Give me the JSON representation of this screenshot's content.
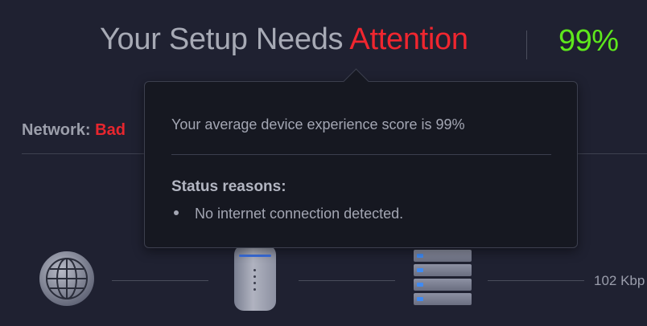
{
  "header": {
    "title_prefix": "Your Setup Needs",
    "title_accent": "Attention",
    "score": "99%"
  },
  "network": {
    "label": "Network:",
    "status": "Bad"
  },
  "topology": {
    "speed": "102 Kbp"
  },
  "tooltip": {
    "score_text": "Your average device experience score is 99%",
    "reasons_heading": "Status reasons:",
    "reasons": [
      "No internet connection detected."
    ]
  },
  "colors": {
    "background": "#1f2131",
    "attention": "#f0262f",
    "score_good": "#5ee81c",
    "status_bad": "#e8262e"
  },
  "icons": [
    "globe-icon",
    "router-icon",
    "server-icon"
  ]
}
